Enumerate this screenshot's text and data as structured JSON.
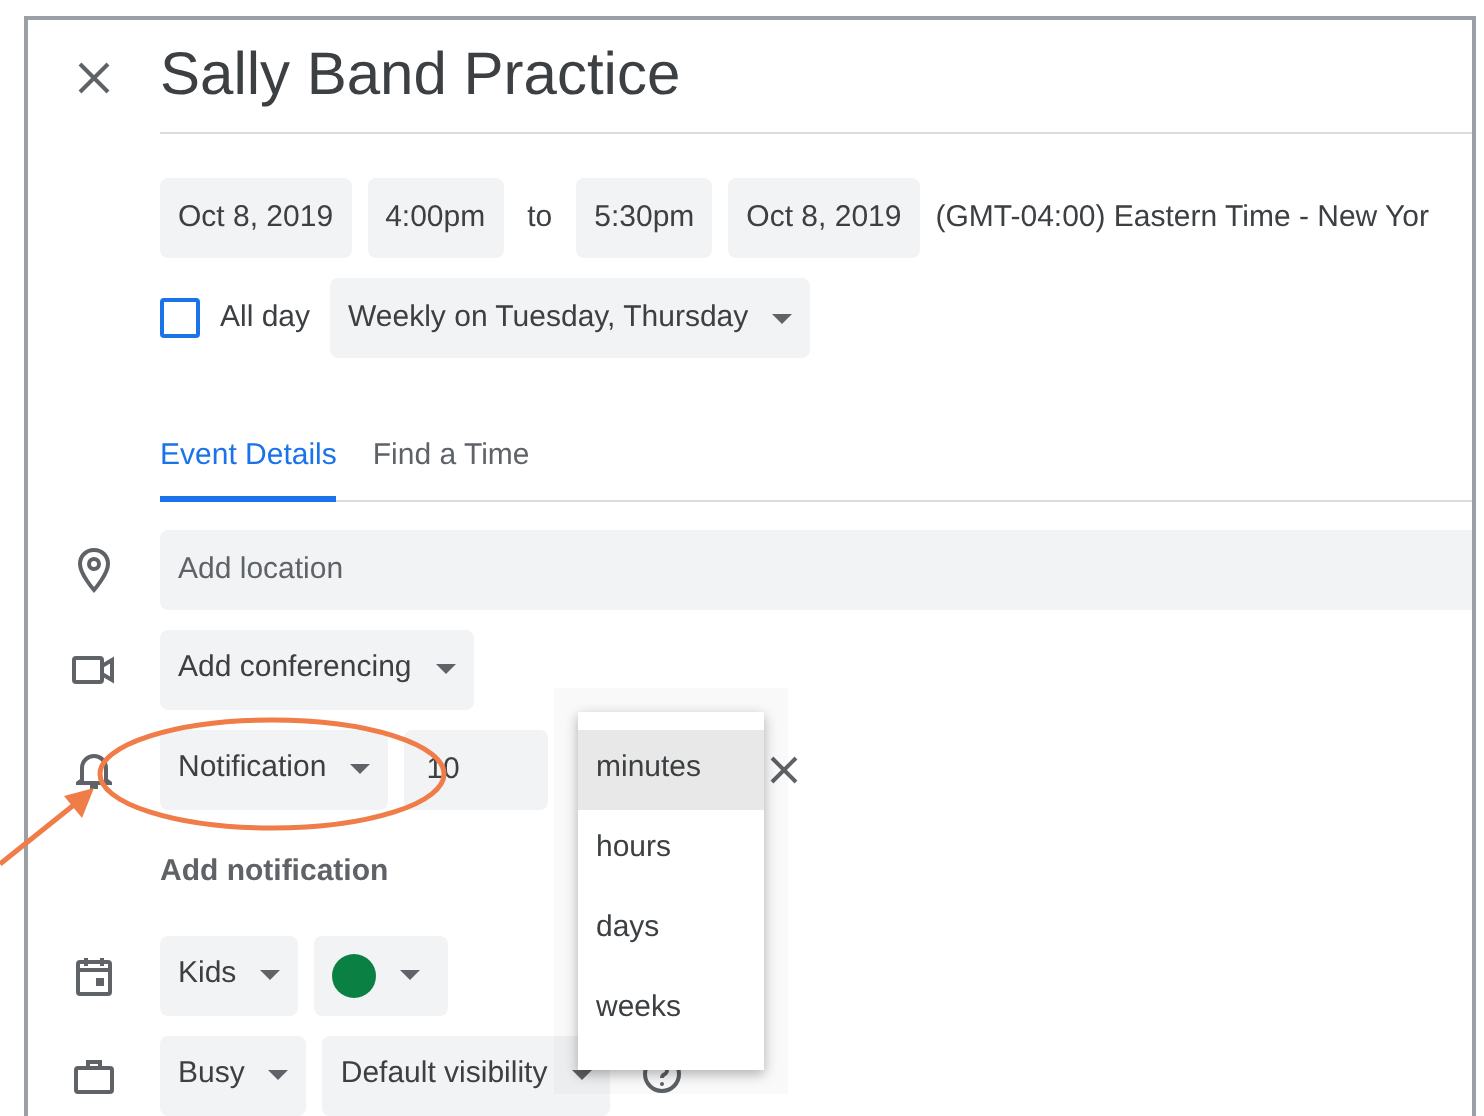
{
  "event": {
    "title": "Sally Band Practice"
  },
  "date_row": {
    "start_date": "Oct 8, 2019",
    "start_time": "4:00pm",
    "separator": "to",
    "end_time": "5:30pm",
    "end_date": "Oct 8, 2019",
    "timezone": "(GMT-04:00) Eastern Time - New Yor"
  },
  "all_day": {
    "label": "All day",
    "checked": false
  },
  "recurrence": {
    "label": "Weekly on Tuesday, Thursday"
  },
  "tabs": [
    {
      "label": "Event Details",
      "selected": true
    },
    {
      "label": "Find a Time",
      "selected": false
    }
  ],
  "location": {
    "placeholder": "Add location"
  },
  "conferencing": {
    "label": "Add conferencing"
  },
  "notification": {
    "type": "Notification",
    "value": "10",
    "unit_menu": [
      {
        "label": "minutes",
        "selected": true
      },
      {
        "label": "hours",
        "selected": false
      },
      {
        "label": "days",
        "selected": false
      },
      {
        "label": "weeks",
        "selected": false
      }
    ]
  },
  "add_notification": "Add notification",
  "calendar": {
    "label": "Kids",
    "color": "#0b8043"
  },
  "availability": {
    "label": "Busy"
  },
  "visibility": {
    "label": "Default visibility"
  }
}
